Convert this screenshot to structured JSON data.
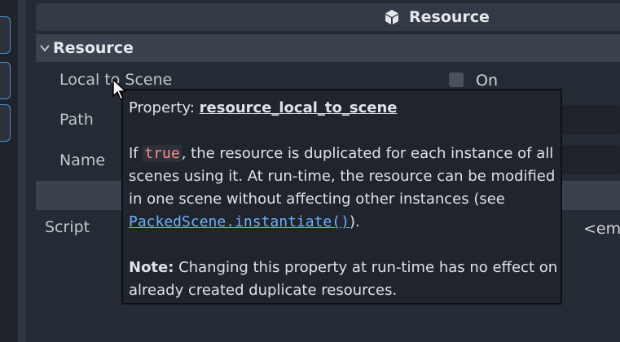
{
  "inspector": {
    "header_title": "Resource",
    "section_title": "Resource",
    "properties": {
      "local_to_scene_label": "Local to Scene",
      "local_to_scene_value": "On",
      "path_label": "Path",
      "name_label": "Name",
      "script_label": "Script",
      "script_value": "<em"
    }
  },
  "tooltip": {
    "property_prefix": "Property: ",
    "property_name": "resource_local_to_scene",
    "desc_part1": "If ",
    "desc_code": "true",
    "desc_part2": ", the resource is duplicated for each instance of all scenes using it. At run-time, the resource can be modified in one scene without affecting other instances (see ",
    "desc_link": "PackedScene.instantiate()",
    "desc_part3": ").",
    "note_label": "Note:",
    "note_text": " Changing this property at run-time has no effect on already created duplicate resources."
  },
  "colors": {
    "accent_blue": "#4a90d9",
    "link": "#6cb0ff",
    "code": "#ff8c8c"
  }
}
